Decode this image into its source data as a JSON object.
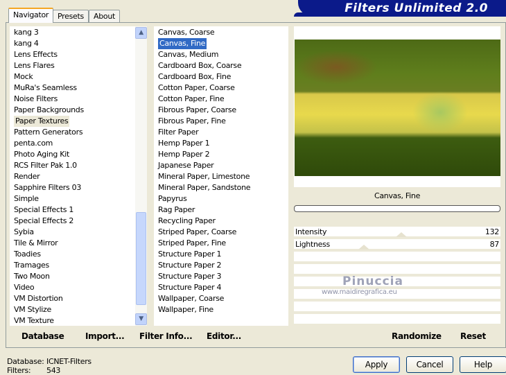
{
  "banner": {
    "title": "Filters Unlimited 2.0"
  },
  "tabs": [
    {
      "label": "Navigator"
    },
    {
      "label": "Presets"
    },
    {
      "label": "About"
    }
  ],
  "categories": [
    "kang 3",
    "kang 4",
    "Lens Effects",
    "Lens Flares",
    "Mock",
    "MuRa's Seamless",
    "Noise Filters",
    "Paper Backgrounds",
    "Paper Textures",
    "Pattern Generators",
    "penta.com",
    "Photo Aging Kit",
    "RCS Filter Pak 1.0",
    "Render",
    "Sapphire Filters 03",
    "Simple",
    "Special Effects 1",
    "Special Effects 2",
    "Sybia",
    "Tile & Mirror",
    "Toadies",
    "Tramages",
    "Two Moon",
    "Video",
    "VM Distortion",
    "VM Stylize",
    "VM Texture"
  ],
  "selected_category": "Paper Textures",
  "filters": [
    "Canvas, Coarse",
    "Canvas, Fine",
    "Canvas, Medium",
    "Cardboard Box, Coarse",
    "Cardboard Box, Fine",
    "Cotton Paper, Coarse",
    "Cotton Paper, Fine",
    "Fibrous Paper, Coarse",
    "Fibrous Paper, Fine",
    "Filter Paper",
    "Hemp Paper 1",
    "Hemp Paper 2",
    "Japanese Paper",
    "Mineral Paper, Limestone",
    "Mineral Paper, Sandstone",
    "Papyrus",
    "Rag Paper",
    "Recycling Paper",
    "Striped Paper, Coarse",
    "Striped Paper, Fine",
    "Structure Paper 1",
    "Structure Paper 2",
    "Structure Paper 3",
    "Structure Paper 4",
    "Wallpaper, Coarse",
    "Wallpaper, Fine"
  ],
  "selected_filter": "Canvas, Fine",
  "preview": {
    "filter_name": "Canvas, Fine",
    "progress": 0
  },
  "params": [
    {
      "label": "Intensity",
      "value": "132",
      "fraction": 0.52
    },
    {
      "label": "Lightness",
      "value": "87",
      "fraction": 0.34
    }
  ],
  "watermark": {
    "name": "Pinuccia",
    "url": "www.maidiregrafica.eu"
  },
  "bottom_buttons": {
    "database": "Database",
    "import": "Import...",
    "filter_info": "Filter Info...",
    "editor": "Editor...",
    "randomize": "Randomize",
    "reset": "Reset"
  },
  "status": {
    "database_label": "Database:",
    "database_value": "ICNET-Filters",
    "filters_label": "Filters:",
    "filters_value": "543"
  },
  "dialog_buttons": {
    "apply": "Apply",
    "cancel": "Cancel",
    "help": "Help"
  }
}
